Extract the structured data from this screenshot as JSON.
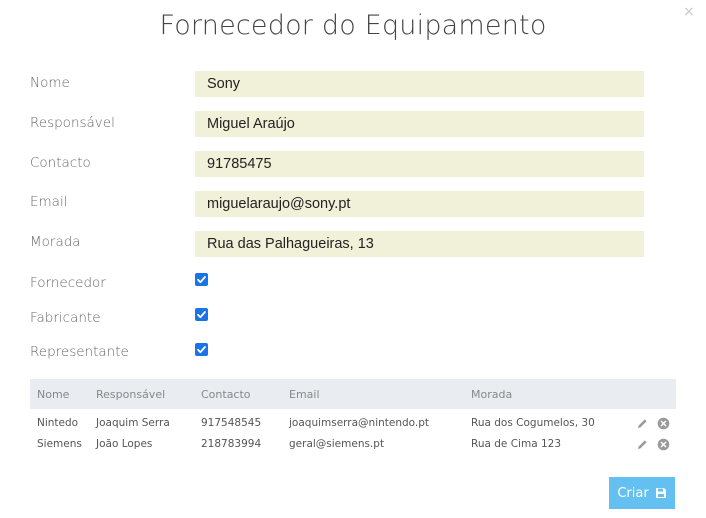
{
  "dialog": {
    "title": "Fornecedor do Equipamento",
    "close_symbol": "×"
  },
  "form": {
    "nome_label": "Nome",
    "nome_value": "Sony",
    "responsavel_label": "Responsável",
    "responsavel_value": "Miguel Araújo",
    "contacto_label": "Contacto",
    "contacto_value": "91785475",
    "email_label": "Email",
    "email_value": "miguelaraujo@sony.pt",
    "morada_label": "Morada",
    "morada_value": "Rua das Palhagueiras, 13",
    "fornecedor_label": "Fornecedor",
    "fornecedor_checked": true,
    "fabricante_label": "Fabricante",
    "fabricante_checked": true,
    "representante_label": "Representante",
    "representante_checked": true
  },
  "table": {
    "headers": [
      "Nome",
      "Responsável",
      "Contacto",
      "Email",
      "Morada"
    ],
    "rows": [
      [
        "Nintedo",
        "Joaquim Serra",
        "917548545",
        "joaquimserra@nintendo.pt",
        "Rua dos Cogumelos, 30"
      ],
      [
        "Siemens",
        "João Lopes",
        "218783994",
        "geral@siemens.pt",
        "Rua de Cima 123"
      ]
    ],
    "row_icons": [
      "pencil-icon",
      "circle-x-icon"
    ]
  },
  "actions": {
    "create_label": "Criar",
    "create_icon": "floppy-disk-icon"
  },
  "colors": {
    "field_bg": "#f1f0d9",
    "checkbox": "#1a73e8",
    "table_header_bg": "#e9ecf0",
    "button_bg": "#63c0f0"
  }
}
